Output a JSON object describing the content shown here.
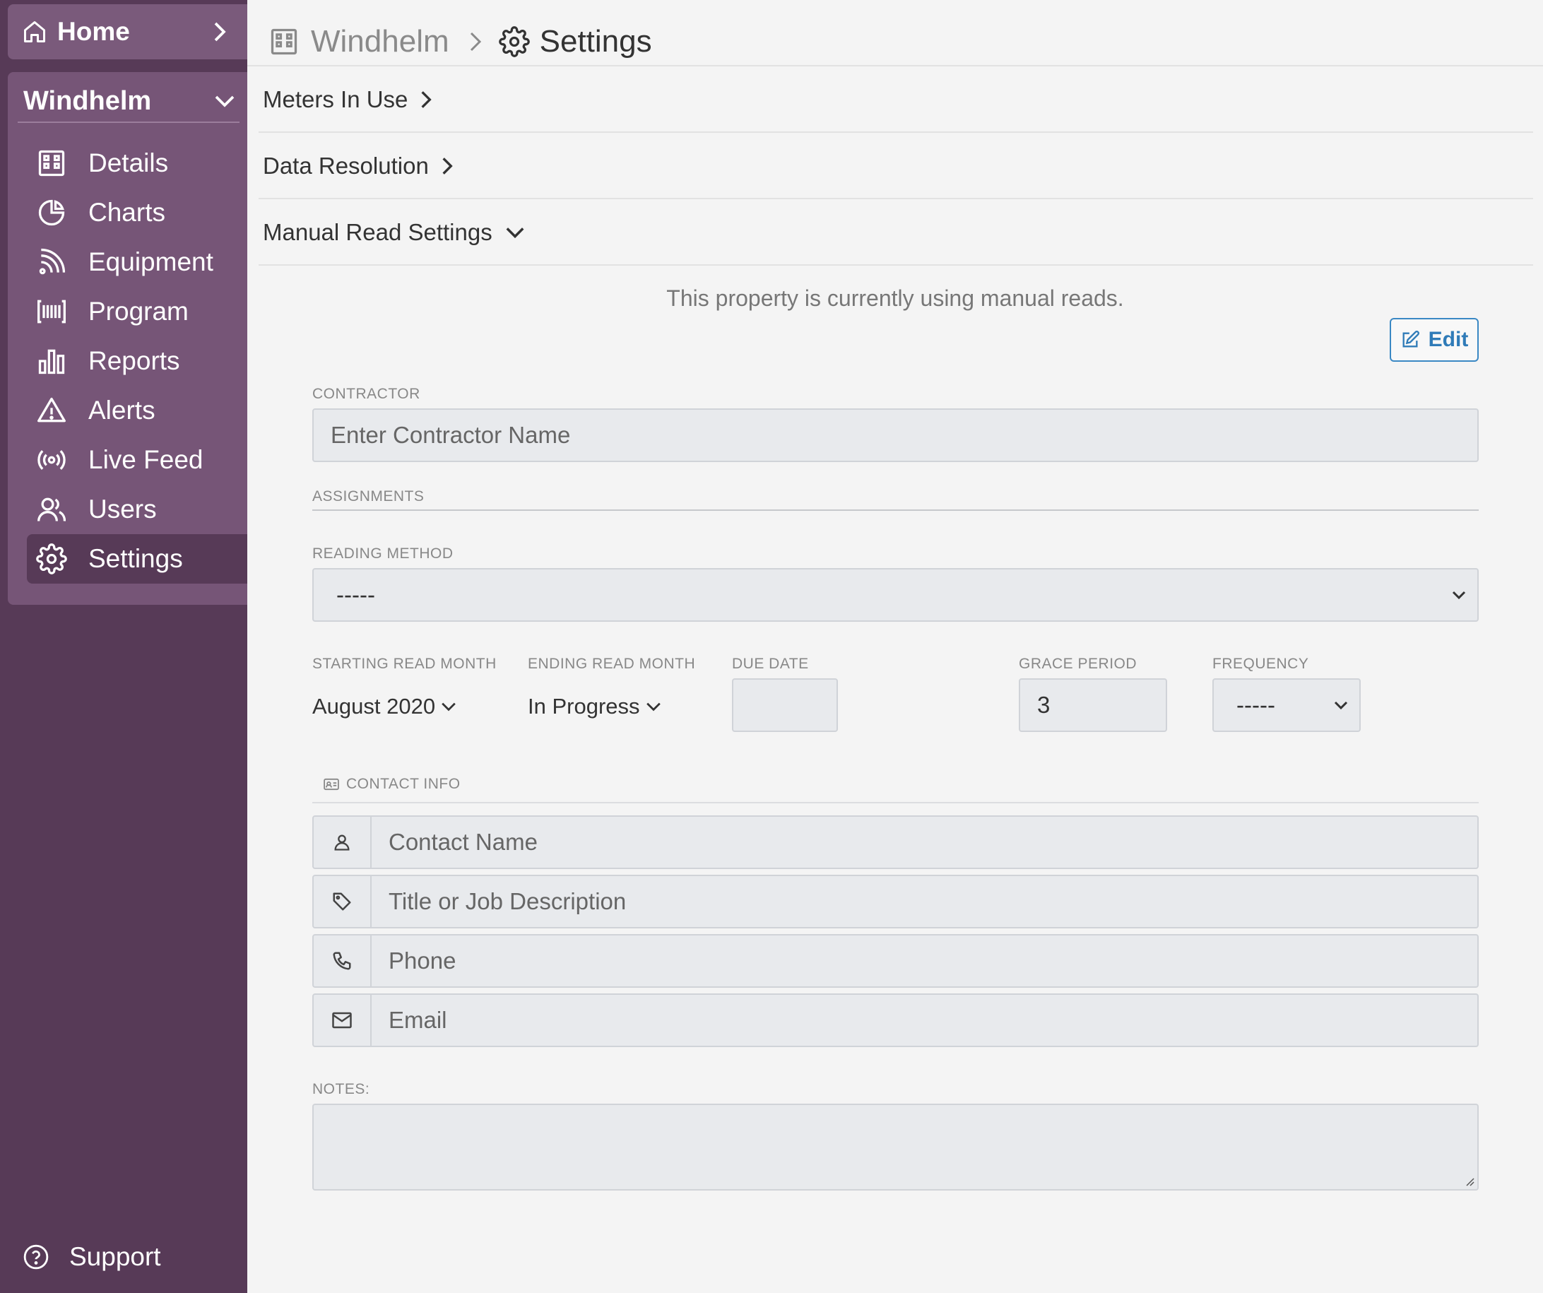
{
  "sidebar": {
    "home_label": "Home",
    "property_name": "Windhelm",
    "nav": [
      {
        "label": "Details",
        "icon": "building-icon"
      },
      {
        "label": "Charts",
        "icon": "pie-chart-icon"
      },
      {
        "label": "Equipment",
        "icon": "signal-icon"
      },
      {
        "label": "Program",
        "icon": "barcode-icon"
      },
      {
        "label": "Reports",
        "icon": "bar-chart-icon"
      },
      {
        "label": "Alerts",
        "icon": "warning-icon"
      },
      {
        "label": "Live Feed",
        "icon": "broadcast-icon"
      },
      {
        "label": "Users",
        "icon": "users-icon"
      },
      {
        "label": "Settings",
        "icon": "gear-icon",
        "active": true
      }
    ],
    "support_label": "Support"
  },
  "breadcrumb": {
    "property": "Windhelm",
    "current": "Settings"
  },
  "accordion": {
    "meters": "Meters In Use",
    "resolution": "Data Resolution",
    "manual": "Manual Read Settings"
  },
  "manual_read": {
    "info_text": "This property is currently using manual reads.",
    "edit_label": "Edit",
    "contractor_label": "CONTRACTOR",
    "contractor_placeholder": "Enter Contractor Name",
    "assignments_label": "ASSIGNMENTS",
    "reading_method_label": "READING METHOD",
    "reading_method_value": "-----",
    "starting_month_label": "STARTING READ MONTH",
    "starting_month_value": "August 2020",
    "ending_month_label": "ENDING READ MONTH",
    "ending_month_value": "In Progress",
    "due_date_label": "DUE DATE",
    "due_date_value": "",
    "grace_period_label": "GRACE PERIOD",
    "grace_period_value": "3",
    "frequency_label": "FREQUENCY",
    "frequency_value": "-----",
    "contact_info_label": "CONTACT INFO",
    "contact_name_placeholder": "Contact Name",
    "title_placeholder": "Title or Job Description",
    "phone_placeholder": "Phone",
    "email_placeholder": "Email",
    "notes_label": "NOTES:"
  },
  "colors": {
    "sidebar_bg": "#573a57",
    "sidebar_panel": "#765577",
    "accent": "#2f7bb8"
  }
}
